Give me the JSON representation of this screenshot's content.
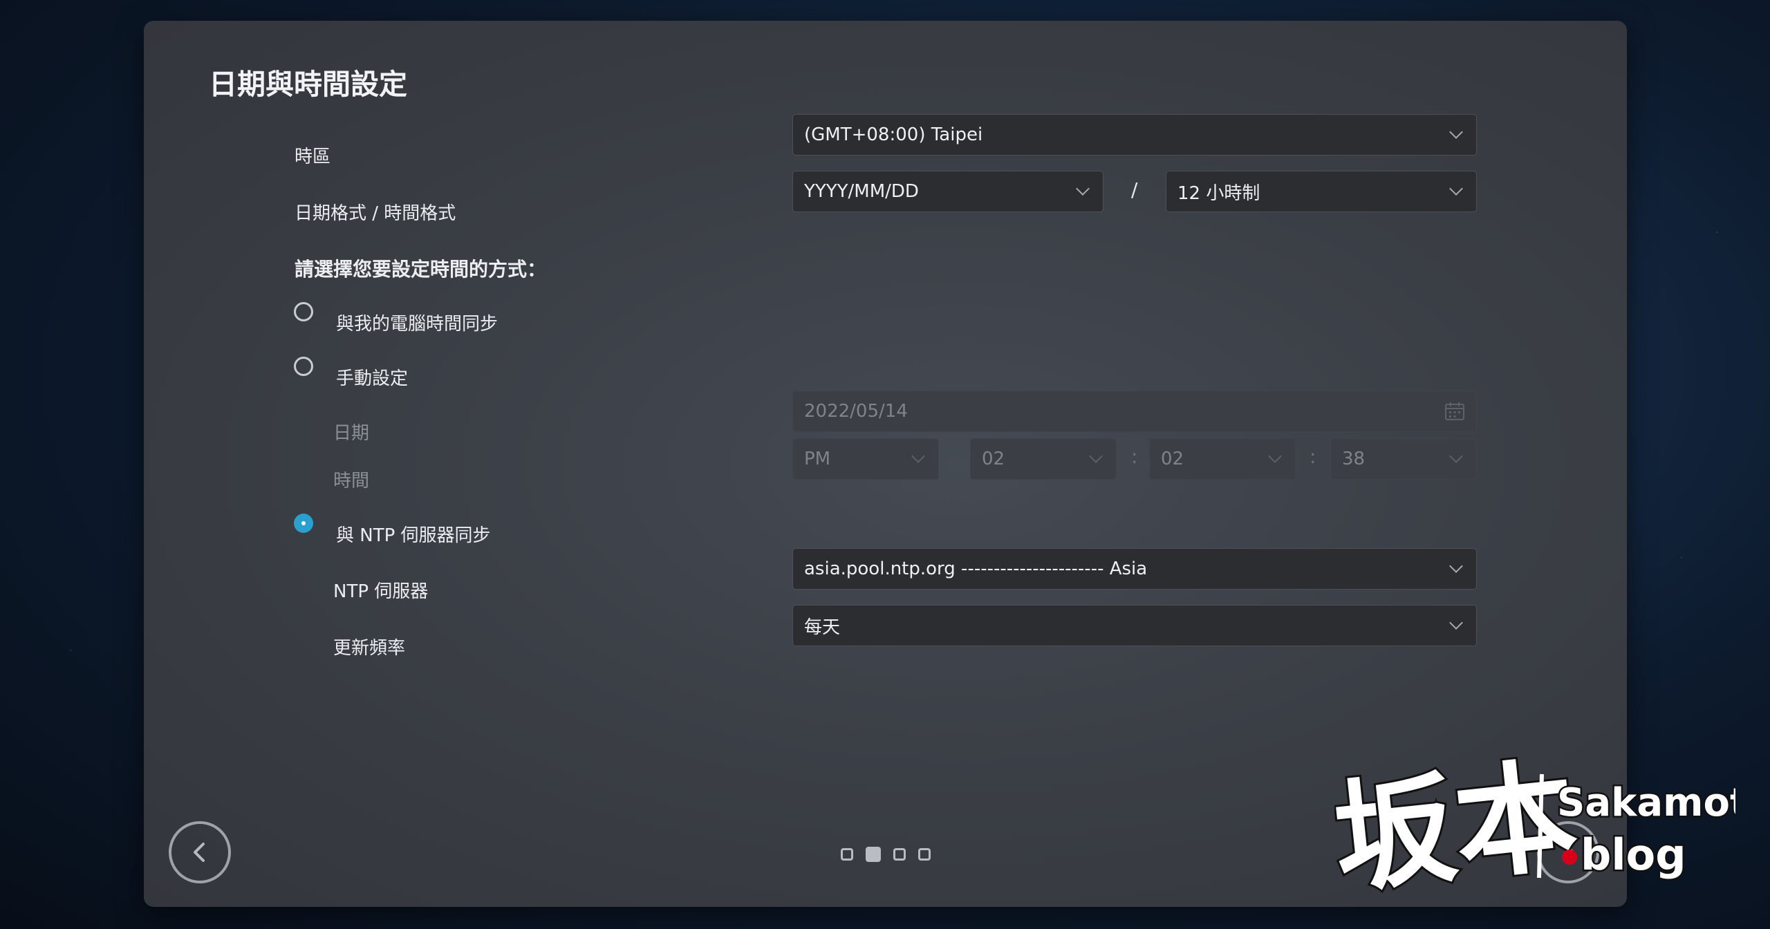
{
  "title": "日期與時間設定",
  "timezone": {
    "label": "時區",
    "value": "(GMT+08:00) Taipei"
  },
  "format": {
    "label": "日期格式 / 時間格式",
    "date_value": "YYYY/MM/DD",
    "separator": "/",
    "time_value": "12 小時制"
  },
  "method": {
    "heading": "請選擇您要設定時間的方式：",
    "options": [
      {
        "label": "與我的電腦時間同步",
        "selected": false
      },
      {
        "label": "手動設定",
        "selected": false
      },
      {
        "label": "與 NTP 伺服器同步",
        "selected": true
      }
    ]
  },
  "manual": {
    "date_label": "日期",
    "date_value": "2022/05/14",
    "time_label": "時間",
    "ampm": "PM",
    "hour": "02",
    "minute": "02",
    "second": "38",
    "colon": ":"
  },
  "ntp": {
    "server_label": "NTP 伺服器",
    "server_value": "asia.pool.ntp.org ---------------------- Asia",
    "frequency_label": "更新頻率",
    "frequency_value": "每天"
  },
  "pager": {
    "total": 4,
    "active": 2
  },
  "watermark": {
    "cjk": "坂本",
    "latin_top": "Sakamoto",
    "latin_bottom": ".blog"
  },
  "colors": {
    "accent": "#2a9fd0",
    "watermark_dot": "#d7001a"
  }
}
